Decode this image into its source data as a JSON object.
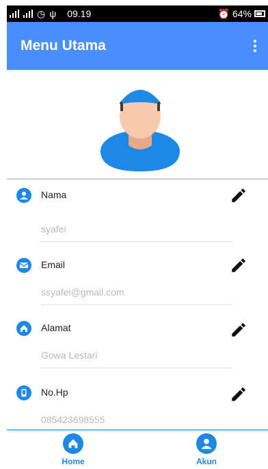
{
  "status_bar": {
    "time": "09.19",
    "battery": "64%"
  },
  "appbar": {
    "title": "Menu Utama"
  },
  "profile": {
    "fields": [
      {
        "label": "Nama",
        "value": "syafei",
        "icon": "person-icon"
      },
      {
        "label": "Email",
        "value": "ssyafei@gmail.com",
        "icon": "mail-icon"
      },
      {
        "label": "Alamat",
        "value": "Gowa Lestari",
        "icon": "home-icon"
      },
      {
        "label": "No.Hp",
        "value": "085423698555",
        "icon": "phone-icon"
      }
    ]
  },
  "bottom_nav": {
    "home_label": "Home",
    "account_label": "Akun"
  },
  "colors": {
    "appbar": "#4a8dfc",
    "icon": "#1e88e5",
    "nav_border": "#4dd0e1"
  }
}
